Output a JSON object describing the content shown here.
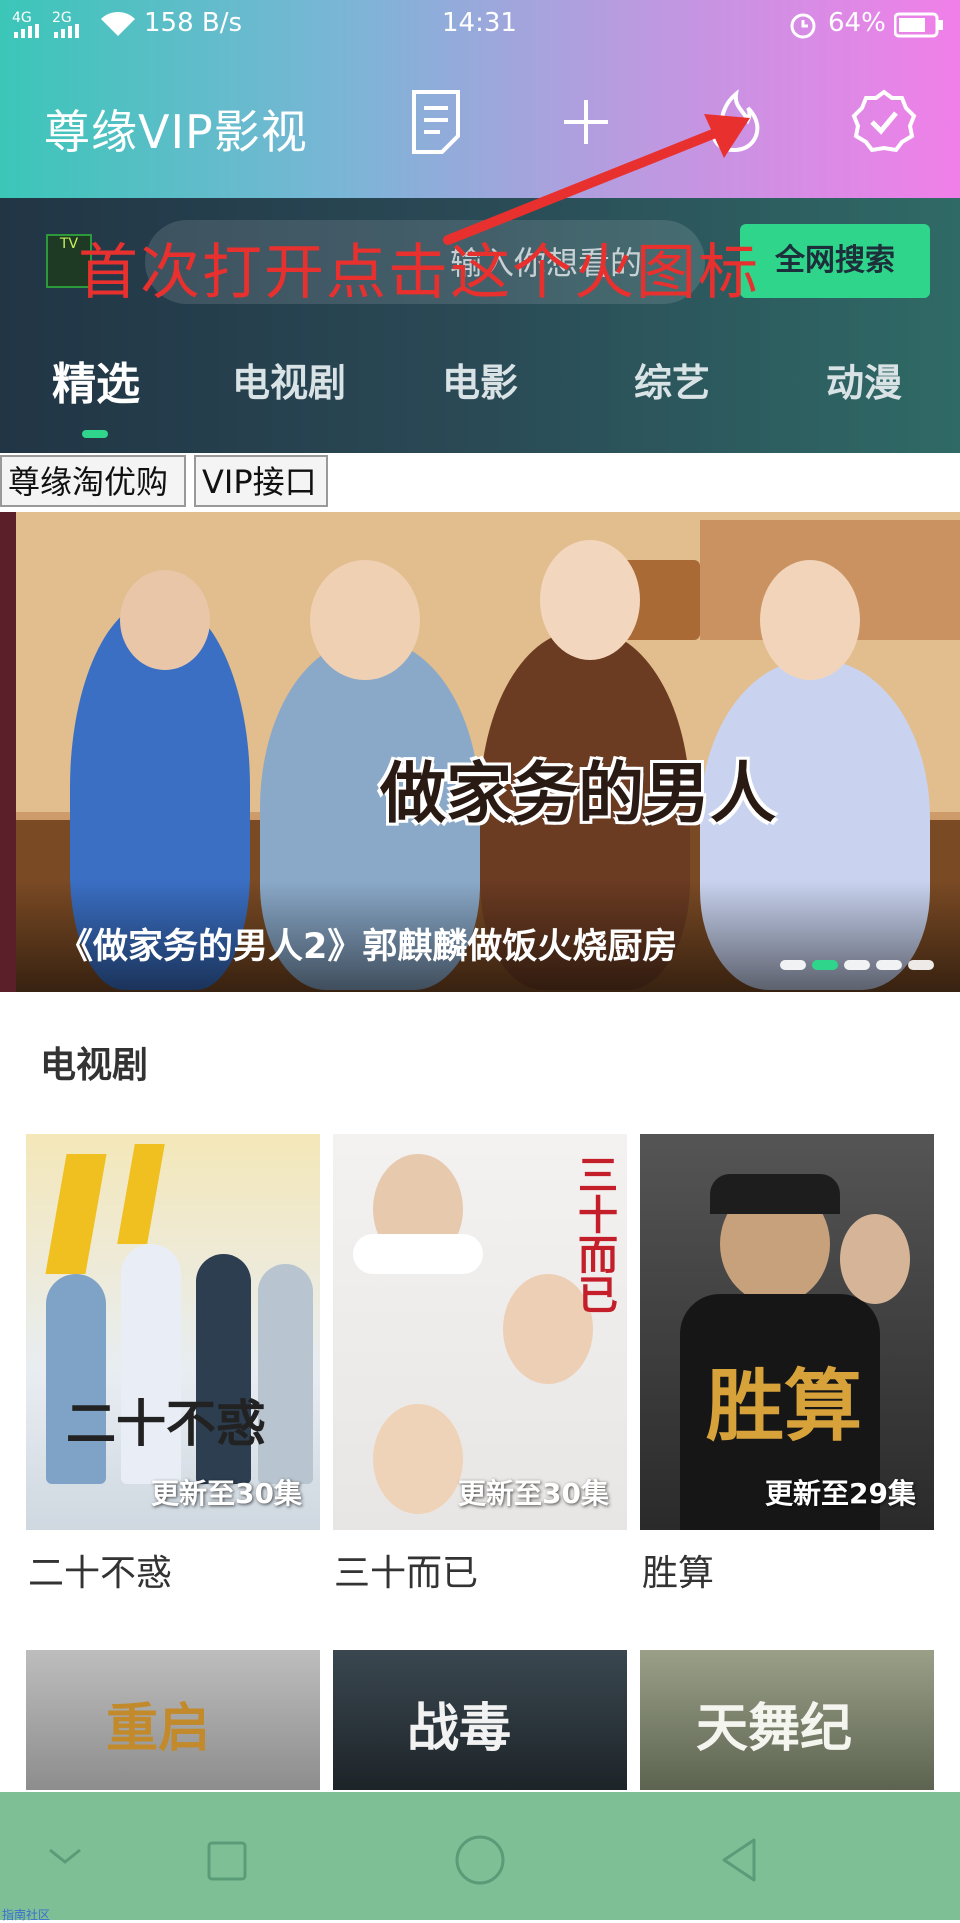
{
  "status_bar": {
    "network1": "4G",
    "network2": "2G",
    "speed": "158 B/s",
    "time": "14:31",
    "battery": "64%"
  },
  "app_bar": {
    "title": "尊缘VIP影视",
    "icons": [
      "document-icon",
      "plus-icon",
      "fire-icon",
      "verified-icon"
    ]
  },
  "search": {
    "placeholder": "输入你想看的",
    "button_label": "全网搜索",
    "logo_text": "TV"
  },
  "annotation": {
    "text": "首次打开点击这个火图标",
    "color": "#e8312f"
  },
  "tabs": [
    {
      "label": "精选",
      "active": true
    },
    {
      "label": "电视剧",
      "active": false
    },
    {
      "label": "电影",
      "active": false
    },
    {
      "label": "综艺",
      "active": false
    },
    {
      "label": "动漫",
      "active": false
    }
  ],
  "quick_buttons": [
    "尊缘淘优购",
    "VIP接口"
  ],
  "banner": {
    "logo_text": "做家务的男人",
    "title": "《做家务的男人2》郭麒麟做饭火烧厨房",
    "dot_count": 5,
    "active_dot": 1
  },
  "section": {
    "title": "电视剧",
    "items": [
      {
        "name": "二十不惑",
        "badge": "更新至30集",
        "poster_text": "二十不惑"
      },
      {
        "name": "三十而已",
        "badge": "更新至30集",
        "poster_text": "三十而已"
      },
      {
        "name": "胜算",
        "badge": "更新至29集",
        "poster_text": "胜算"
      }
    ],
    "second_row": [
      {
        "poster_text": "重启"
      },
      {
        "poster_text": "战毒"
      },
      {
        "poster_text": "天舞纪"
      }
    ]
  },
  "nav_bar": {
    "buttons": [
      "collapse-icon",
      "recents-icon",
      "home-icon",
      "back-icon"
    ]
  },
  "watermark": "指南社区",
  "colors": {
    "accent": "#2ed58a",
    "nav_bar": "#7fbf96"
  }
}
